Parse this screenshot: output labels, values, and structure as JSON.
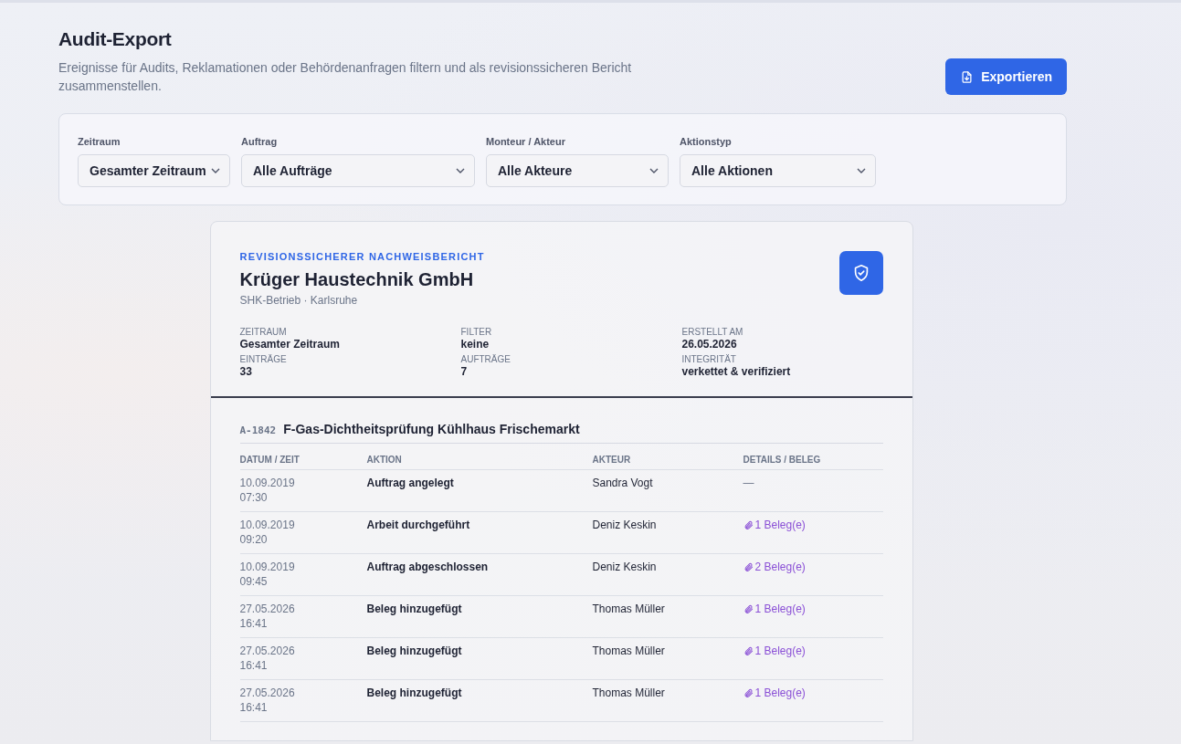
{
  "page": {
    "title": "Audit-Export",
    "description": "Ereignisse für Audits, Reklamationen oder Behördenanfragen filtern und als revisionssicheren Bericht zusammenstellen.",
    "export_button": "Exportieren"
  },
  "filters": [
    {
      "label": "Zeitraum",
      "value": "Gesamter Zeitraum"
    },
    {
      "label": "Auftrag",
      "value": "Alle Aufträge"
    },
    {
      "label": "Monteur / Akteur",
      "value": "Alle Akteure"
    },
    {
      "label": "Aktionstyp",
      "value": "Alle Aktionen"
    }
  ],
  "report": {
    "eyebrow": "REVISIONSSICHERER NACHWEISBERICHT",
    "company": "Krüger Haustechnik GmbH",
    "subtitle": "SHK-Betrieb · Karlsruhe",
    "meta": [
      {
        "label": "ZEITRAUM",
        "value": "Gesamter Zeitraum"
      },
      {
        "label": "FILTER",
        "value": "keine"
      },
      {
        "label": "ERSTELLT AM",
        "value": "26.05.2026"
      },
      {
        "label": "EINTRÄGE",
        "value": "33"
      },
      {
        "label": "AUFTRÄGE",
        "value": "7"
      },
      {
        "label": "INTEGRITÄT",
        "value": "verkettet & verifiziert"
      }
    ]
  },
  "orders": [
    {
      "code": "A-1842",
      "title": "F-Gas-Dichtheitsprüfung Kühlhaus Frischemarkt",
      "columns": [
        "DATUM / ZEIT",
        "AKTION",
        "AKTEUR",
        "DETAILS / BELEG"
      ],
      "rows": [
        {
          "date": "10.09.2019",
          "time": "07:30",
          "action": "Auftrag angelegt",
          "actor": "Sandra Vogt",
          "details": "—",
          "kind": "none"
        },
        {
          "date": "10.09.2019",
          "time": "09:20",
          "action": "Arbeit durchgeführt",
          "actor": "Deniz Keskin",
          "details": "1 Beleg(e)",
          "kind": "attachment"
        },
        {
          "date": "10.09.2019",
          "time": "09:45",
          "action": "Auftrag abgeschlossen",
          "actor": "Deniz Keskin",
          "details": "2 Beleg(e)",
          "kind": "attachment"
        },
        {
          "date": "27.05.2026",
          "time": "16:41",
          "action": "Beleg hinzugefügt",
          "actor": "Thomas Müller",
          "details": "1 Beleg(e)",
          "kind": "attachment"
        },
        {
          "date": "27.05.2026",
          "time": "16:41",
          "action": "Beleg hinzugefügt",
          "actor": "Thomas Müller",
          "details": "1 Beleg(e)",
          "kind": "attachment"
        },
        {
          "date": "27.05.2026",
          "time": "16:41",
          "action": "Beleg hinzugefügt",
          "actor": "Thomas Müller",
          "details": "1 Beleg(e)",
          "kind": "attachment"
        }
      ]
    }
  ]
}
